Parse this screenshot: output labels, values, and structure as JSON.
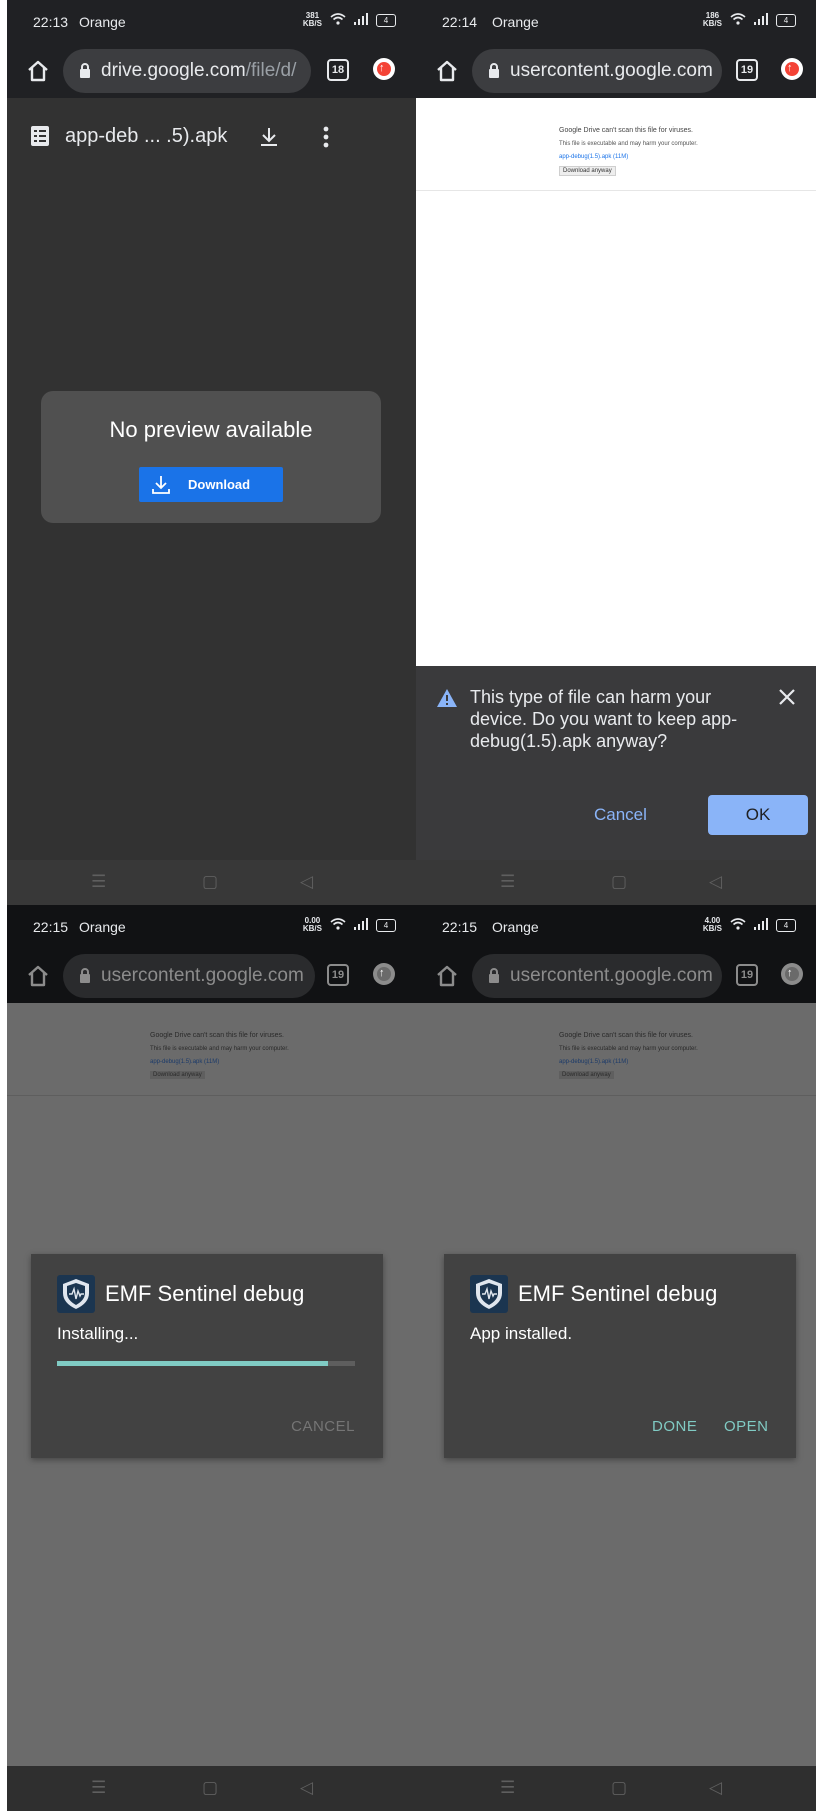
{
  "panel1": {
    "status": {
      "time": "22:13",
      "carrier": "Orange",
      "speed": "381",
      "speed_unit": "KB/S",
      "battery": "4"
    },
    "browser": {
      "url_host": "drive.google.com",
      "url_path": "/file/d/",
      "tab_count": "18"
    },
    "file": {
      "name": "app-deb ... .5).apk"
    },
    "preview": {
      "message": "No preview available",
      "download_label": "Download"
    }
  },
  "panel2": {
    "status": {
      "time": "22:14",
      "carrier": "Orange",
      "speed": "186",
      "speed_unit": "KB/S",
      "battery": "4"
    },
    "browser": {
      "url": "usercontent.google.com",
      "tab_count": "19"
    },
    "page": {
      "line1": "Google Drive can't scan this file for viruses.",
      "line2": "This file is executable and may harm your computer.",
      "line3": "app-debug(1.5).apk (11M)",
      "button": "Download anyway"
    },
    "warning": {
      "message": "This type of file can harm your device. Do you want to keep app-debug(1.5).apk anyway?",
      "cancel_label": "Cancel",
      "ok_label": "OK"
    }
  },
  "panel3": {
    "status": {
      "time": "22:15",
      "carrier": "Orange",
      "speed": "0.00",
      "speed_unit": "KB/S",
      "battery": "4"
    },
    "browser": {
      "url": "usercontent.google.com",
      "tab_count": "19"
    },
    "page": {
      "line1": "Google Drive can't scan this file for viruses.",
      "line2": "This file is executable and may harm your computer.",
      "line3": "app-debug(1.5).apk (11M)",
      "button": "Download anyway"
    },
    "dialog": {
      "app_name": "EMF Sentinel debug",
      "status": "Installing...",
      "progress": 0.91,
      "cancel_label": "CANCEL"
    }
  },
  "panel4": {
    "status": {
      "time": "22:15",
      "carrier": "Orange",
      "speed": "4.00",
      "speed_unit": "KB/S",
      "battery": "4"
    },
    "browser": {
      "url": "usercontent.google.com",
      "tab_count": "19"
    },
    "page": {
      "line1": "Google Drive can't scan this file for viruses.",
      "line2": "This file is executable and may harm your computer.",
      "line3": "app-debug(1.5).apk (11M)",
      "button": "Download anyway"
    },
    "dialog": {
      "app_name": "EMF Sentinel debug",
      "status": "App installed.",
      "done_label": "DONE",
      "open_label": "OPEN"
    }
  },
  "nav": {
    "recent": "☰",
    "home": "▢",
    "back": "◁"
  },
  "colors": {
    "accent_blue": "#1a73e8",
    "light_blue": "#8ab4f8",
    "teal": "#80cbc4",
    "dialog_bg": "#424242"
  }
}
